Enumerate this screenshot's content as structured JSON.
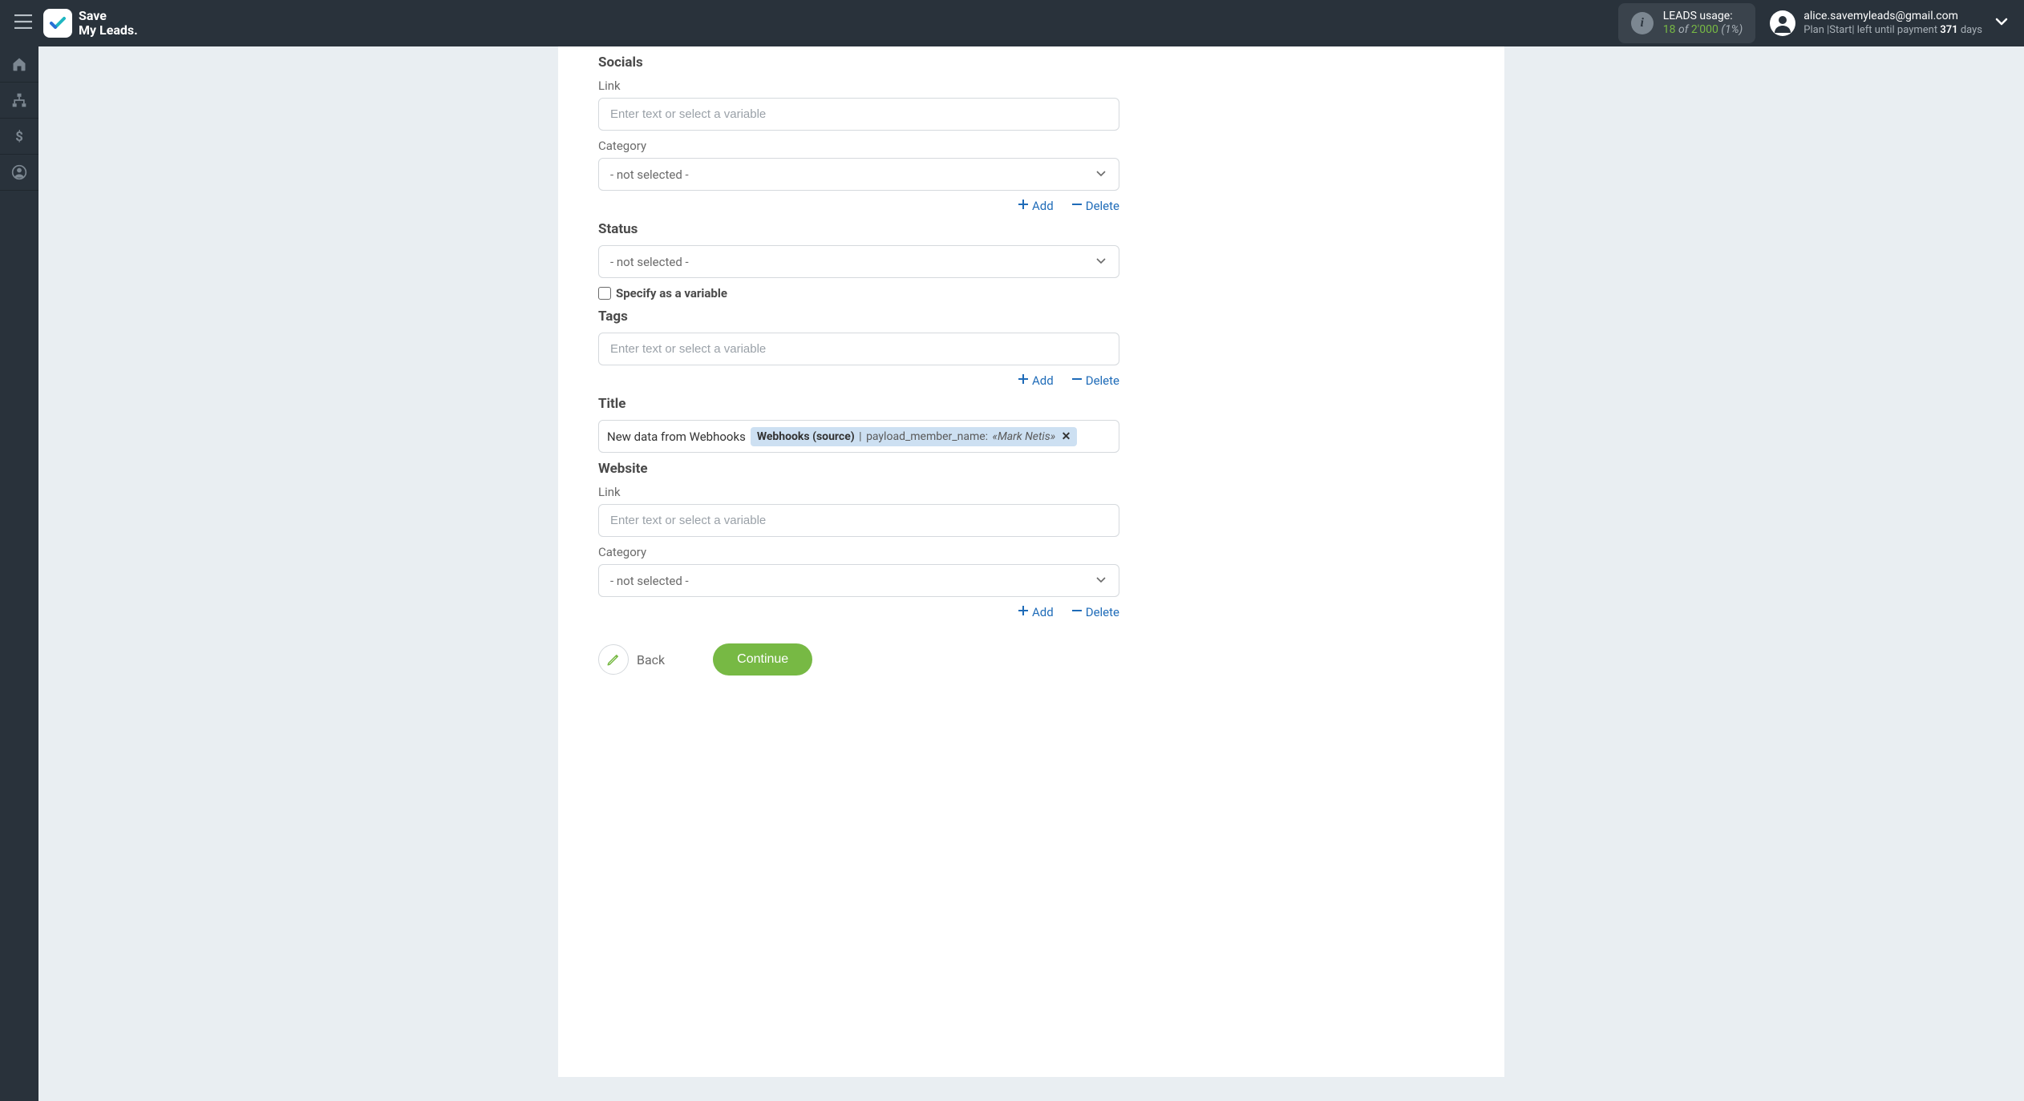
{
  "header": {
    "logo_line1": "Save",
    "logo_line2": "My Leads.",
    "usage_label": "LEADS usage:",
    "usage_used": "18",
    "usage_of": "of",
    "usage_limit": "2'000",
    "usage_pct": "(1%)",
    "user_email": "alice.savemyleads@gmail.com",
    "plan_prefix": "Plan  |",
    "plan_name": "Start",
    "plan_mid": "|  left until payment ",
    "plan_days": "371",
    "plan_suffix": " days"
  },
  "form": {
    "socials_title": "Socials",
    "link_label": "Link",
    "input_placeholder": "Enter text or select a variable",
    "category_label": "Category",
    "not_selected": "- not selected -",
    "add_label": "Add",
    "delete_label": "Delete",
    "status_title": "Status",
    "specify_variable": "Specify as a variable",
    "tags_title": "Tags",
    "title_title": "Title",
    "title_text": "New data from Webhooks",
    "chip_source": "Webhooks (source)",
    "chip_field": "payload_member_name:",
    "chip_value": "«Mark Netis»",
    "website_title": "Website",
    "back_label": "Back",
    "continue_label": "Continue"
  }
}
